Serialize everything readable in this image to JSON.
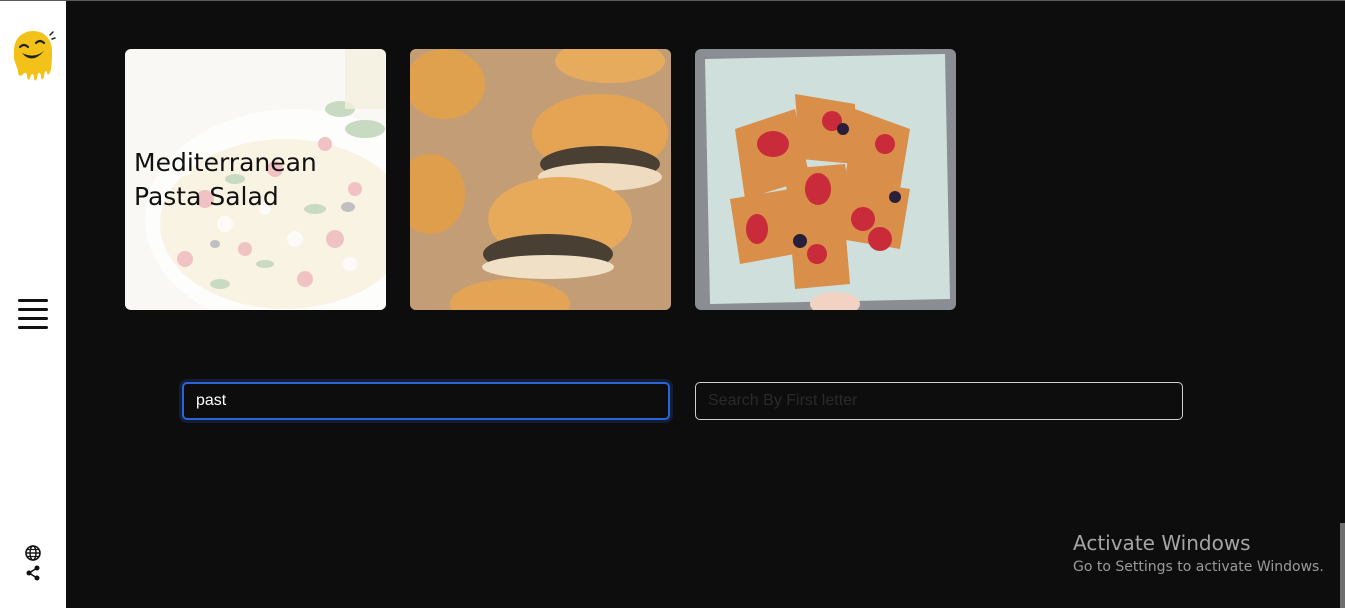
{
  "sidebar": {
    "logo": "smiley-logo-icon",
    "menu": "hamburger-menu-icon",
    "bottom_icons": [
      "globe-icon",
      "share-icon"
    ]
  },
  "cards": [
    {
      "title": "Mediterranean Pasta Salad",
      "image": "pasta-salad-image"
    },
    {
      "title": "",
      "image": "sausage-rolls-image"
    },
    {
      "title": "",
      "image": "berry-danish-image"
    }
  ],
  "search": {
    "name_value": "past",
    "letter_placeholder": "Search By First letter"
  },
  "watermark": {
    "title": "Activate Windows",
    "subtitle": "Go to Settings to activate Windows."
  },
  "colors": {
    "background": "#0d0d0d",
    "sidebar": "#ffffff",
    "focus": "#2b63d9",
    "logo": "#f2c218"
  }
}
